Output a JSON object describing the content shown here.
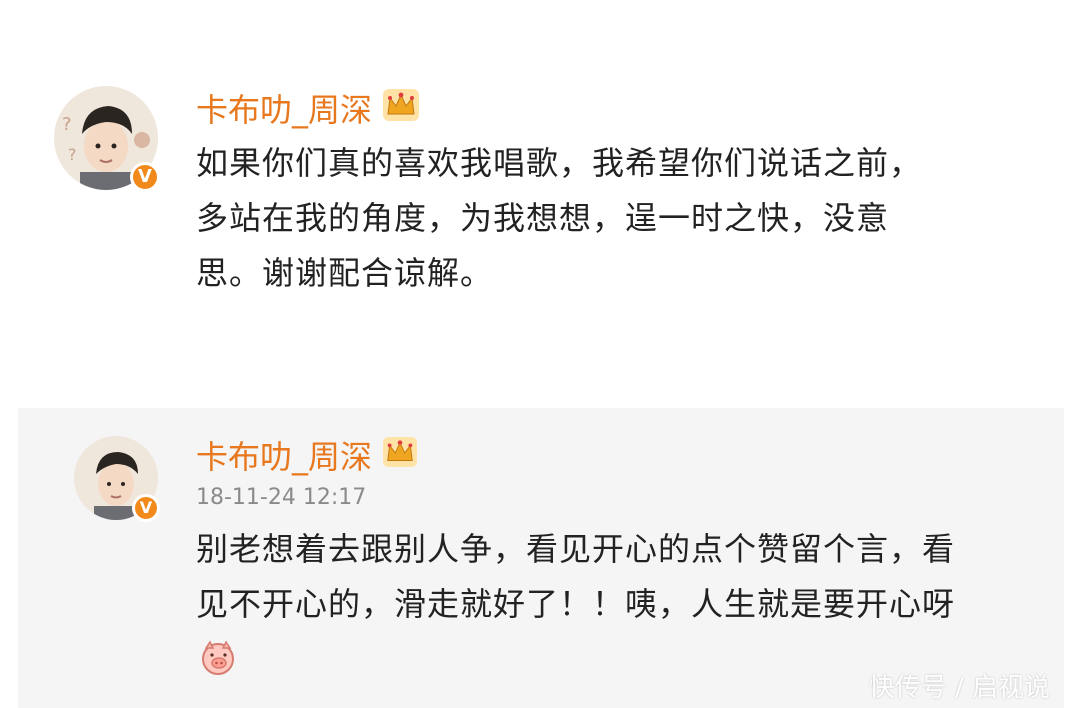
{
  "posts": [
    {
      "username": "卡布叻_周深",
      "lines": [
        "如果你们真的喜欢我唱歌，我希望你们说话之前，",
        "多站在我的角度，为我想想，逞一时之快，没意",
        "思。谢谢配合谅解。"
      ],
      "verified_badge": "V",
      "crown_icon": "crown-icon"
    },
    {
      "username": "卡布叻_周深",
      "timestamp": "18-11-24 12:17",
      "lines": [
        "别老想着去跟别人争，看见开心的点个赞留个言，看",
        "见不开心的，滑走就好了！！咦，人生就是要开心呀"
      ],
      "verified_badge": "V",
      "crown_icon": "crown-icon",
      "emoji_icon": "pig-face-emoji-icon"
    }
  ],
  "watermark": "快传号 / 启视说",
  "colors": {
    "username": "#e8781e",
    "badge": "#f28a1b",
    "text": "#222222",
    "timestamp": "#8a8a8a",
    "card_bg": "#f5f5f5"
  }
}
